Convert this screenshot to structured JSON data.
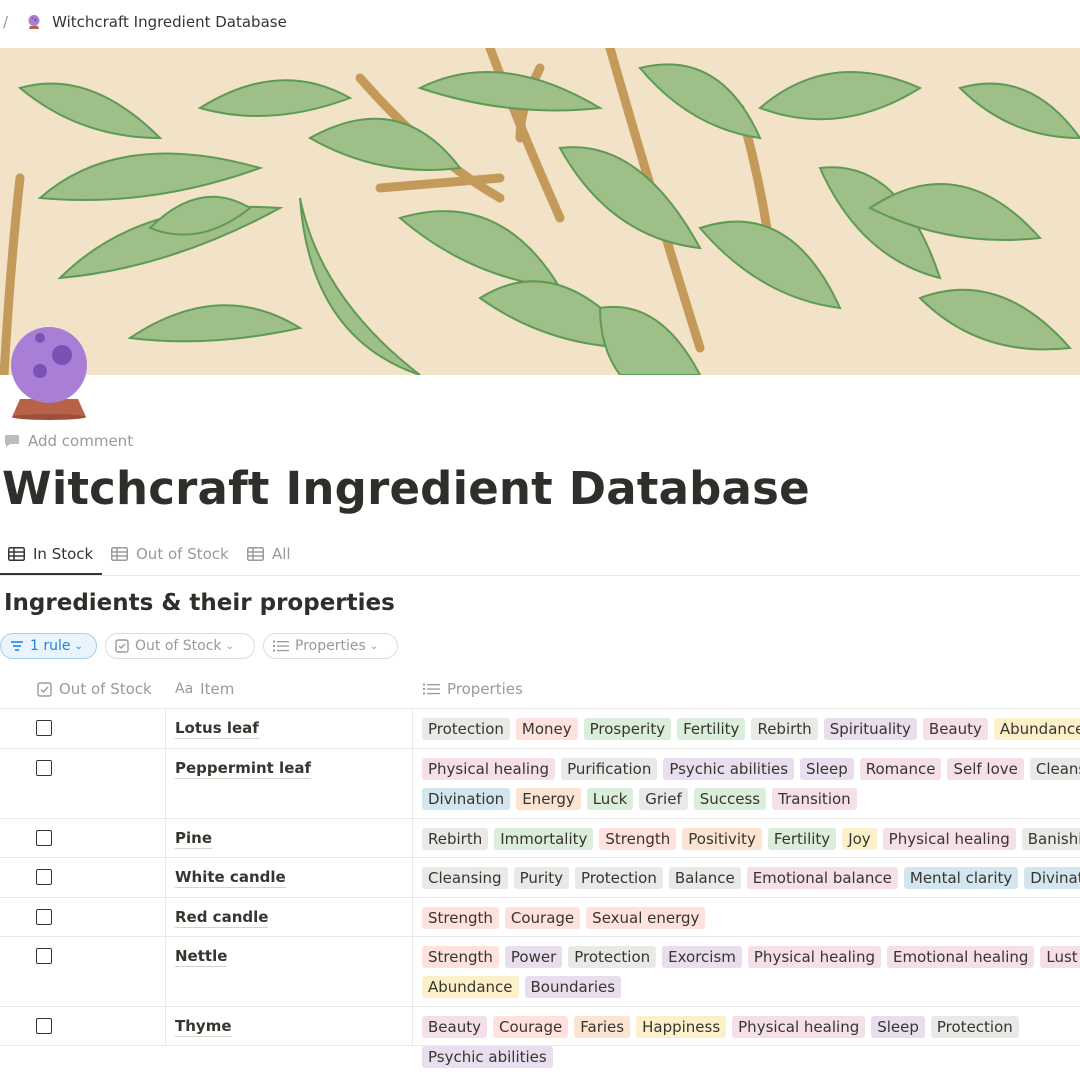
{
  "breadcrumb": {
    "separator": "/",
    "page_title": "Witchcraft Ingredient Database"
  },
  "page": {
    "add_comment": "Add comment",
    "title": "Witchcraft Ingredient Database"
  },
  "tabs": [
    {
      "label": "In Stock",
      "active": true
    },
    {
      "label": "Out of Stock",
      "active": false
    },
    {
      "label": "All",
      "active": false
    }
  ],
  "database": {
    "title": "Ingredients & their properties"
  },
  "filters": {
    "rule": "1 rule",
    "out_of_stock": "Out of Stock",
    "properties": "Properties"
  },
  "columns": {
    "out_of_stock": "Out of Stock",
    "item": "Item",
    "properties": "Properties"
  },
  "tag_colors": {
    "gray": "#e9e9e7",
    "brown": "#ede3dc",
    "orange": "#fbe4d1",
    "yellow": "#fbf0c9",
    "green": "#dbeddb",
    "blue": "#d3e5ef",
    "purple": "#e8deee",
    "pink": "#f5e0e9",
    "red": "#ffe2dd"
  },
  "rows": [
    {
      "item": "Lotus leaf",
      "out_of_stock": false,
      "tags": [
        {
          "t": "Protection",
          "c": "gray"
        },
        {
          "t": "Money",
          "c": "red"
        },
        {
          "t": "Prosperity",
          "c": "green"
        },
        {
          "t": "Fertility",
          "c": "green"
        },
        {
          "t": "Rebirth",
          "c": "gray"
        },
        {
          "t": "Spirituality",
          "c": "purple"
        },
        {
          "t": "Beauty",
          "c": "pink"
        },
        {
          "t": "Abundance",
          "c": "yellow"
        }
      ]
    },
    {
      "item": "Peppermint leaf",
      "out_of_stock": false,
      "tags": [
        {
          "t": "Physical healing",
          "c": "pink"
        },
        {
          "t": "Purification",
          "c": "gray"
        },
        {
          "t": "Psychic abilities",
          "c": "purple"
        },
        {
          "t": "Sleep",
          "c": "purple"
        },
        {
          "t": "Romance",
          "c": "pink"
        },
        {
          "t": "Self love",
          "c": "pink"
        },
        {
          "t": "Cleansing",
          "c": "gray"
        },
        {
          "t": "Divination",
          "c": "blue"
        },
        {
          "t": "Energy",
          "c": "orange"
        },
        {
          "t": "Luck",
          "c": "green"
        },
        {
          "t": "Grief",
          "c": "gray"
        },
        {
          "t": "Success",
          "c": "green"
        },
        {
          "t": "Transition",
          "c": "pink"
        }
      ]
    },
    {
      "item": "Pine",
      "out_of_stock": false,
      "tags": [
        {
          "t": "Rebirth",
          "c": "gray"
        },
        {
          "t": "Immortality",
          "c": "green"
        },
        {
          "t": "Strength",
          "c": "red"
        },
        {
          "t": "Positivity",
          "c": "orange"
        },
        {
          "t": "Fertility",
          "c": "green"
        },
        {
          "t": "Joy",
          "c": "yellow"
        },
        {
          "t": "Physical healing",
          "c": "pink"
        },
        {
          "t": "Banishing",
          "c": "gray"
        }
      ]
    },
    {
      "item": "White candle",
      "out_of_stock": false,
      "tags": [
        {
          "t": "Cleansing",
          "c": "gray"
        },
        {
          "t": "Purity",
          "c": "gray"
        },
        {
          "t": "Protection",
          "c": "gray"
        },
        {
          "t": "Balance",
          "c": "gray"
        },
        {
          "t": "Emotional balance",
          "c": "pink"
        },
        {
          "t": "Mental clarity",
          "c": "blue"
        },
        {
          "t": "Divination",
          "c": "blue"
        }
      ]
    },
    {
      "item": "Red candle",
      "out_of_stock": false,
      "tags": [
        {
          "t": "Strength",
          "c": "red"
        },
        {
          "t": "Courage",
          "c": "red"
        },
        {
          "t": "Sexual energy",
          "c": "red"
        }
      ]
    },
    {
      "item": "Nettle",
      "out_of_stock": false,
      "tags": [
        {
          "t": "Strength",
          "c": "red"
        },
        {
          "t": "Power",
          "c": "purple"
        },
        {
          "t": "Protection",
          "c": "gray"
        },
        {
          "t": "Exorcism",
          "c": "purple"
        },
        {
          "t": "Physical healing",
          "c": "pink"
        },
        {
          "t": "Emotional healing",
          "c": "pink"
        },
        {
          "t": "Lust",
          "c": "pink"
        },
        {
          "t": "Abundance",
          "c": "yellow"
        },
        {
          "t": "Boundaries",
          "c": "purple"
        }
      ]
    },
    {
      "item": "Thyme",
      "out_of_stock": false,
      "tags": [
        {
          "t": "Beauty",
          "c": "pink"
        },
        {
          "t": "Courage",
          "c": "red"
        },
        {
          "t": "Faries",
          "c": "orange"
        },
        {
          "t": "Happiness",
          "c": "yellow"
        },
        {
          "t": "Physical healing",
          "c": "pink"
        },
        {
          "t": "Sleep",
          "c": "purple"
        },
        {
          "t": "Protection",
          "c": "gray"
        },
        {
          "t": "Psychic abilities",
          "c": "purple"
        }
      ]
    }
  ]
}
